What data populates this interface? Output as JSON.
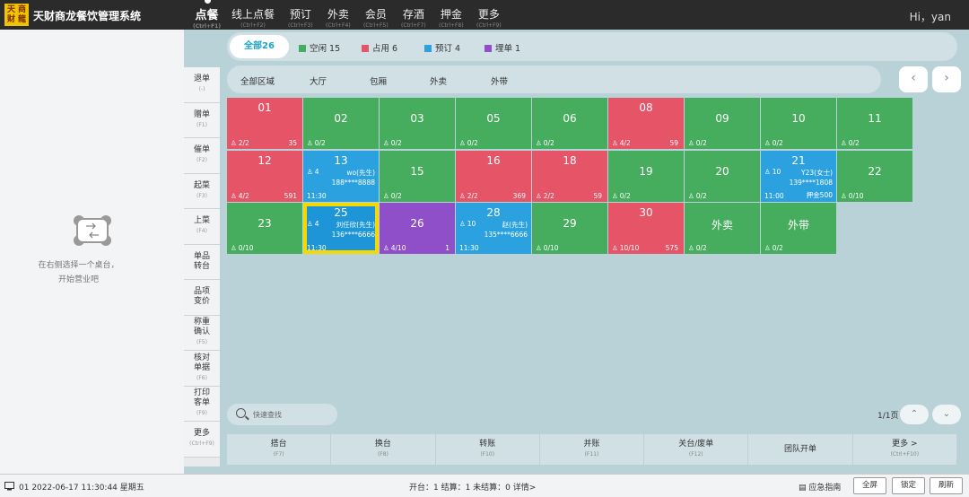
{
  "app": {
    "logo_text": [
      "天",
      "商",
      "财",
      "龍"
    ],
    "title": "天财商龙餐饮管理系统",
    "greeting": "Hi，yan"
  },
  "nav": [
    {
      "label": "点餐",
      "shortcut": "(Ctrl+F1)",
      "active": true
    },
    {
      "label": "线上点餐",
      "shortcut": "(Ctrl+F2)"
    },
    {
      "label": "预订",
      "shortcut": "(Ctrl+F3)"
    },
    {
      "label": "外卖",
      "shortcut": "(Ctrl+F4)"
    },
    {
      "label": "会员",
      "shortcut": "(Ctrl+F5)"
    },
    {
      "label": "存酒",
      "shortcut": "(Ctrl+F7)"
    },
    {
      "label": "押金",
      "shortcut": "(Ctrl+F8)"
    },
    {
      "label": "更多",
      "shortcut": "(Ctrl+F9)"
    }
  ],
  "left_panel": {
    "empty_line1": "在右侧选择一个桌台，",
    "empty_line2": "开始营业吧"
  },
  "actions": [
    {
      "label": "退单",
      "shortcut": "(-)"
    },
    {
      "label": "赠单",
      "shortcut": "(F1)"
    },
    {
      "label": "催单",
      "shortcut": "(F2)"
    },
    {
      "label": "起菜",
      "shortcut": "(F3)"
    },
    {
      "label": "上菜",
      "shortcut": "(F4)"
    },
    {
      "label": "单品\n转台",
      "shortcut": ""
    },
    {
      "label": "品项\n变价",
      "shortcut": ""
    },
    {
      "label": "称重\n确认",
      "shortcut": "(F5)"
    },
    {
      "label": "核对\n单据",
      "shortcut": "(F6)"
    },
    {
      "label": "打印\n客单",
      "shortcut": "(F9)"
    },
    {
      "label": "更多",
      "shortcut": "(Ctrl+F9)"
    }
  ],
  "status_filter": {
    "all": "全部26",
    "items": [
      {
        "label": "空闲 15",
        "color": "#47ad5e"
      },
      {
        "label": "占用 6",
        "color": "#e65468"
      },
      {
        "label": "预订 4",
        "color": "#2ba1df"
      },
      {
        "label": "埋单 1",
        "color": "#8f4fc8"
      }
    ]
  },
  "zones": [
    "全部区域",
    "大厅",
    "包厢",
    "外卖",
    "外带"
  ],
  "tables": [
    {
      "num": "01",
      "status": "busy",
      "guests": "2/2",
      "amount": "35"
    },
    {
      "num": "02",
      "status": "free",
      "guests": "0/2"
    },
    {
      "num": "03",
      "status": "free",
      "guests": "0/2"
    },
    {
      "num": "05",
      "status": "free",
      "guests": "0/2"
    },
    {
      "num": "06",
      "status": "free",
      "guests": "0/2"
    },
    {
      "num": "08",
      "status": "busy",
      "guests": "4/2",
      "amount": "59"
    },
    {
      "num": "09",
      "status": "free",
      "guests": "0/2"
    },
    {
      "num": "10",
      "status": "free",
      "guests": "0/2"
    },
    {
      "num": "11",
      "status": "free",
      "guests": "0/2"
    },
    {
      "num": "12",
      "status": "busy",
      "guests": "4/2",
      "amount": "591"
    },
    {
      "num": "13",
      "status": "reserved",
      "people": "4",
      "customer": "wo(先生)",
      "phone": "188****8888",
      "time": "11:30"
    },
    {
      "num": "15",
      "status": "free",
      "guests": "0/2"
    },
    {
      "num": "16",
      "status": "busy",
      "guests": "2/2",
      "amount": "369"
    },
    {
      "num": "18",
      "status": "busy",
      "guests": "2/2",
      "amount": "59"
    },
    {
      "num": "19",
      "status": "free",
      "guests": "0/2"
    },
    {
      "num": "20",
      "status": "free",
      "guests": "0/2"
    },
    {
      "num": "21",
      "status": "reserved",
      "people": "10",
      "customer": "Y23(女士)",
      "phone": "139****1808",
      "time": "11:00",
      "deposit": "押金500"
    },
    {
      "num": "22",
      "status": "free",
      "guests": "0/10"
    },
    {
      "num": "23",
      "status": "free",
      "guests": "0/10"
    },
    {
      "num": "25",
      "status": "reserved",
      "selected": true,
      "people": "4",
      "customer": "刘任欣(先生)",
      "phone": "136****6666",
      "time": "11:30"
    },
    {
      "num": "26",
      "status": "bill",
      "guests": "4/10",
      "amount": "1"
    },
    {
      "num": "28",
      "status": "reserved",
      "people": "10",
      "customer": "赵(先生)",
      "phone": "135****6666",
      "time": "11:30"
    },
    {
      "num": "29",
      "status": "free",
      "guests": "0/10"
    },
    {
      "num": "30",
      "status": "busy",
      "guests": "10/10",
      "amount": "575"
    },
    {
      "num": "外卖",
      "status": "free",
      "guests": "0/2"
    },
    {
      "num": "外带",
      "status": "free",
      "guests": "0/2"
    }
  ],
  "search": {
    "placeholder": "快速查找"
  },
  "pager": {
    "info": "1/1页"
  },
  "bottom_actions": [
    {
      "label": "搭台",
      "shortcut": "(F7)"
    },
    {
      "label": "换台",
      "shortcut": "(F8)"
    },
    {
      "label": "转账",
      "shortcut": "(F10)"
    },
    {
      "label": "并账",
      "shortcut": "(F11)"
    },
    {
      "label": "关台/废单",
      "shortcut": "(F12)"
    },
    {
      "label": "团队开单",
      "shortcut": ""
    },
    {
      "label": "更多 >",
      "shortcut": "(Ctrl+F10)"
    }
  ],
  "footer": {
    "session": "01 2022-06-17 11:30:44 星期五",
    "stats": "开台：1   结算：1   未结算：0   详情>",
    "guide": "应急指南",
    "buttons": [
      "全屏",
      "锁定",
      "刷新"
    ]
  }
}
